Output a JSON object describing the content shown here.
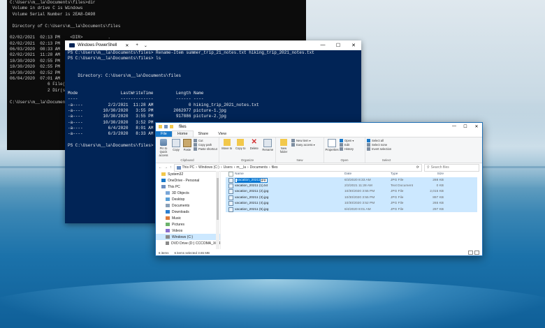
{
  "cmd": {
    "lines": [
      "C:\\Users\\m__la\\Documents\\files>dir",
      " Volume in drive C is Windows",
      " Volume Serial Number is 2EA8-DA98",
      "",
      " Directory of C:\\Users\\m__la\\Documents\\files",
      "",
      "02/02/2021  02:13 PM    <DIR>          .",
      "02/02/2021  02:13 PM    <DIR>          ..",
      "06/03/2020  08:33 AM",
      "02/02/2021  11:28 AM",
      "10/30/2020  02:55 PM",
      "10/30/2020  02:55 PM",
      "10/30/2020  02:52 PM",
      "06/04/2020  07:01 AM",
      "               6 File(",
      "               2 Dir(s",
      "",
      "C:\\Users\\m__la\\Document"
    ]
  },
  "powershell": {
    "title": "Windows PowerShell",
    "add_tab": "+",
    "dropdown": "⌄",
    "minimize": "—",
    "maximize": "☐",
    "close": "✕",
    "lines": [
      "PS C:\\Users\\m__la\\Documents\\files> Rename-Item summer_trip_21_notes.txt hiking_trip_2021_notes.txt",
      "PS C:\\Users\\m__la\\Documents\\files> ls",
      "",
      "",
      "    Directory: C:\\Users\\m__la\\Documents\\files",
      "",
      "",
      "Mode                 LastWriteTime         Length Name",
      "----                 -------------         ------ ----",
      "-a----          2/2/2021  11:28 AM              0 hiking_trip_2021_notes.txt",
      "-a----        10/30/2020   3:55 PM        2062977 picture-1.jpg",
      "-a----        10/30/2020   3:55 PM         917886 picture-2.jpg",
      "-a----        10/30/2020   3:52 PM",
      "-a----          6/4/2020   8:01 AM",
      "-a----          6/3/2020   8:33 AM",
      "",
      "PS C:\\Users\\m__la\\Documents\\files>"
    ]
  },
  "explorer": {
    "title": "files",
    "minimize": "—",
    "maximize": "☐",
    "close": "✕",
    "tabs": [
      "File",
      "Home",
      "Share",
      "View"
    ],
    "ribbon": {
      "pin": "Pin to Quick access",
      "copy": "Copy",
      "paste": "Paste",
      "cut": "Cut",
      "copy_path": "Copy path",
      "paste_shortcut": "Paste shortcut",
      "clipboard": "Clipboard",
      "move_to": "Move to",
      "copy_to": "Copy to",
      "delete": "Delete",
      "rename": "Rename",
      "organize": "Organize",
      "new_folder": "New folder",
      "new_item": "New item ▾",
      "easy_access": "Easy access ▾",
      "new": "New",
      "properties": "Properties",
      "open_dd": "Open ▾",
      "edit": "Edit",
      "history": "History",
      "open": "Open",
      "select_all": "Select all",
      "select_none": "Select none",
      "invert_selection": "Invert selection",
      "select": "Select"
    },
    "address": {
      "back": "←",
      "forward": "→",
      "up": "↑",
      "crumbs": [
        "This PC",
        "Windows (C:)",
        "Users",
        "m__la",
        "Documents",
        "files"
      ],
      "refresh": "⟳",
      "search_placeholder": "Search files"
    },
    "nav": [
      {
        "label": "System32",
        "sub": false,
        "sel": false
      },
      {
        "label": "OneDrive - Personal",
        "sub": false,
        "sel": false
      },
      {
        "label": "This PC",
        "sub": false,
        "sel": false
      },
      {
        "label": "3D Objects",
        "sub": true,
        "sel": false
      },
      {
        "label": "Desktop",
        "sub": true,
        "sel": false
      },
      {
        "label": "Documents",
        "sub": true,
        "sel": false
      },
      {
        "label": "Downloads",
        "sub": true,
        "sel": false
      },
      {
        "label": "Music",
        "sub": true,
        "sel": false
      },
      {
        "label": "Pictures",
        "sub": true,
        "sel": false
      },
      {
        "label": "Videos",
        "sub": true,
        "sel": false
      },
      {
        "label": "Windows (C:)",
        "sub": true,
        "sel": true
      },
      {
        "label": "DVD Drive (D:) CCCOMA_X64FRE_",
        "sub": true,
        "sel": false
      }
    ],
    "columns": {
      "name": "Name",
      "date": "Date",
      "type": "Type",
      "size": "Size"
    },
    "files": [
      {
        "name_sel": "vacation_20211",
        "name_rest": ".jpg",
        "date": "6/3/2020 8:33 AM",
        "type": "JPG File",
        "size": "288 KB"
      },
      {
        "name_sel": "",
        "name_rest": "vacation_20211 (1).txt",
        "date": "2/2/2021 11:28 AM",
        "type": "Text Document",
        "size": "0 KB"
      },
      {
        "name_sel": "",
        "name_rest": "vacation_20211 (2).jpg",
        "date": "10/30/2020 3:55 PM",
        "type": "JPG File",
        "size": "2,015 KB"
      },
      {
        "name_sel": "",
        "name_rest": "vacation_20211 (3).jpg",
        "date": "10/30/2020 3:55 PM",
        "type": "JPG File",
        "size": "897 KB"
      },
      {
        "name_sel": "",
        "name_rest": "vacation_20211 (4).jpg",
        "date": "10/30/2020 3:52 PM",
        "type": "JPG File",
        "size": "265 KB"
      },
      {
        "name_sel": "",
        "name_rest": "vacation_20211 (5).jpg",
        "date": "6/4/2020 8:01 AM",
        "type": "JPG File",
        "size": "297 KB"
      }
    ],
    "status": {
      "items": "6 items",
      "selected": "6 items selected  3.65 MB"
    }
  }
}
